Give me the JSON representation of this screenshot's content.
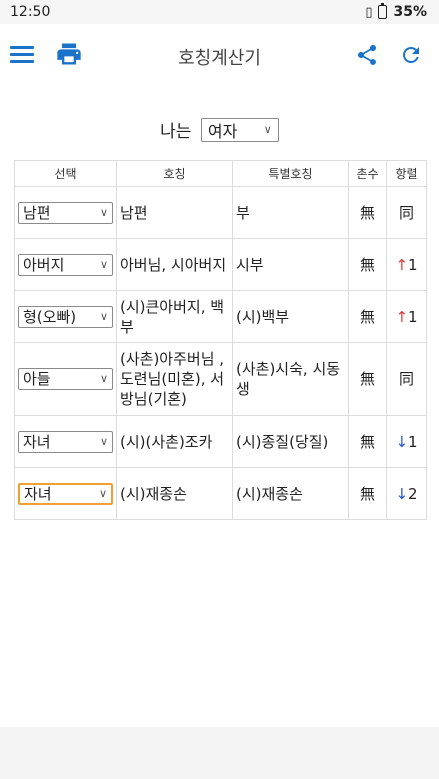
{
  "status": {
    "time": "12:50",
    "battery": "35%"
  },
  "toolbar": {
    "title": "호칭계산기"
  },
  "gender": {
    "label": "나는",
    "value": "여자"
  },
  "table": {
    "headers": [
      "선택",
      "호칭",
      "특별호칭",
      "촌수",
      "항렬"
    ],
    "rows": [
      {
        "select": "남편",
        "title": "남편",
        "special": "부",
        "chon": "無",
        "arrow": "",
        "hang": "同"
      },
      {
        "select": "아버지",
        "title": "아버님, 시아버지",
        "special": "시부",
        "chon": "無",
        "arrow": "↑",
        "hang": "1"
      },
      {
        "select": "형(오빠)",
        "title": "(시)큰아버지, 백부",
        "special": "(시)백부",
        "chon": "無",
        "arrow": "↑",
        "hang": "1"
      },
      {
        "select": "아들",
        "title": "(사촌)아주버님 , 도련님(미혼), 서방님(기혼)",
        "special": "(사촌)시숙, 시동생",
        "chon": "無",
        "arrow": "",
        "hang": "同"
      },
      {
        "select": "자녀",
        "title": "(시)(사촌)조카",
        "special": "(시)종질(당질)",
        "chon": "無",
        "arrow": "↓",
        "hang": "1"
      },
      {
        "select": "자녀",
        "title": "(시)재종손",
        "special": "(시)재종손",
        "chon": "無",
        "arrow": "↓",
        "hang": "2"
      }
    ]
  }
}
